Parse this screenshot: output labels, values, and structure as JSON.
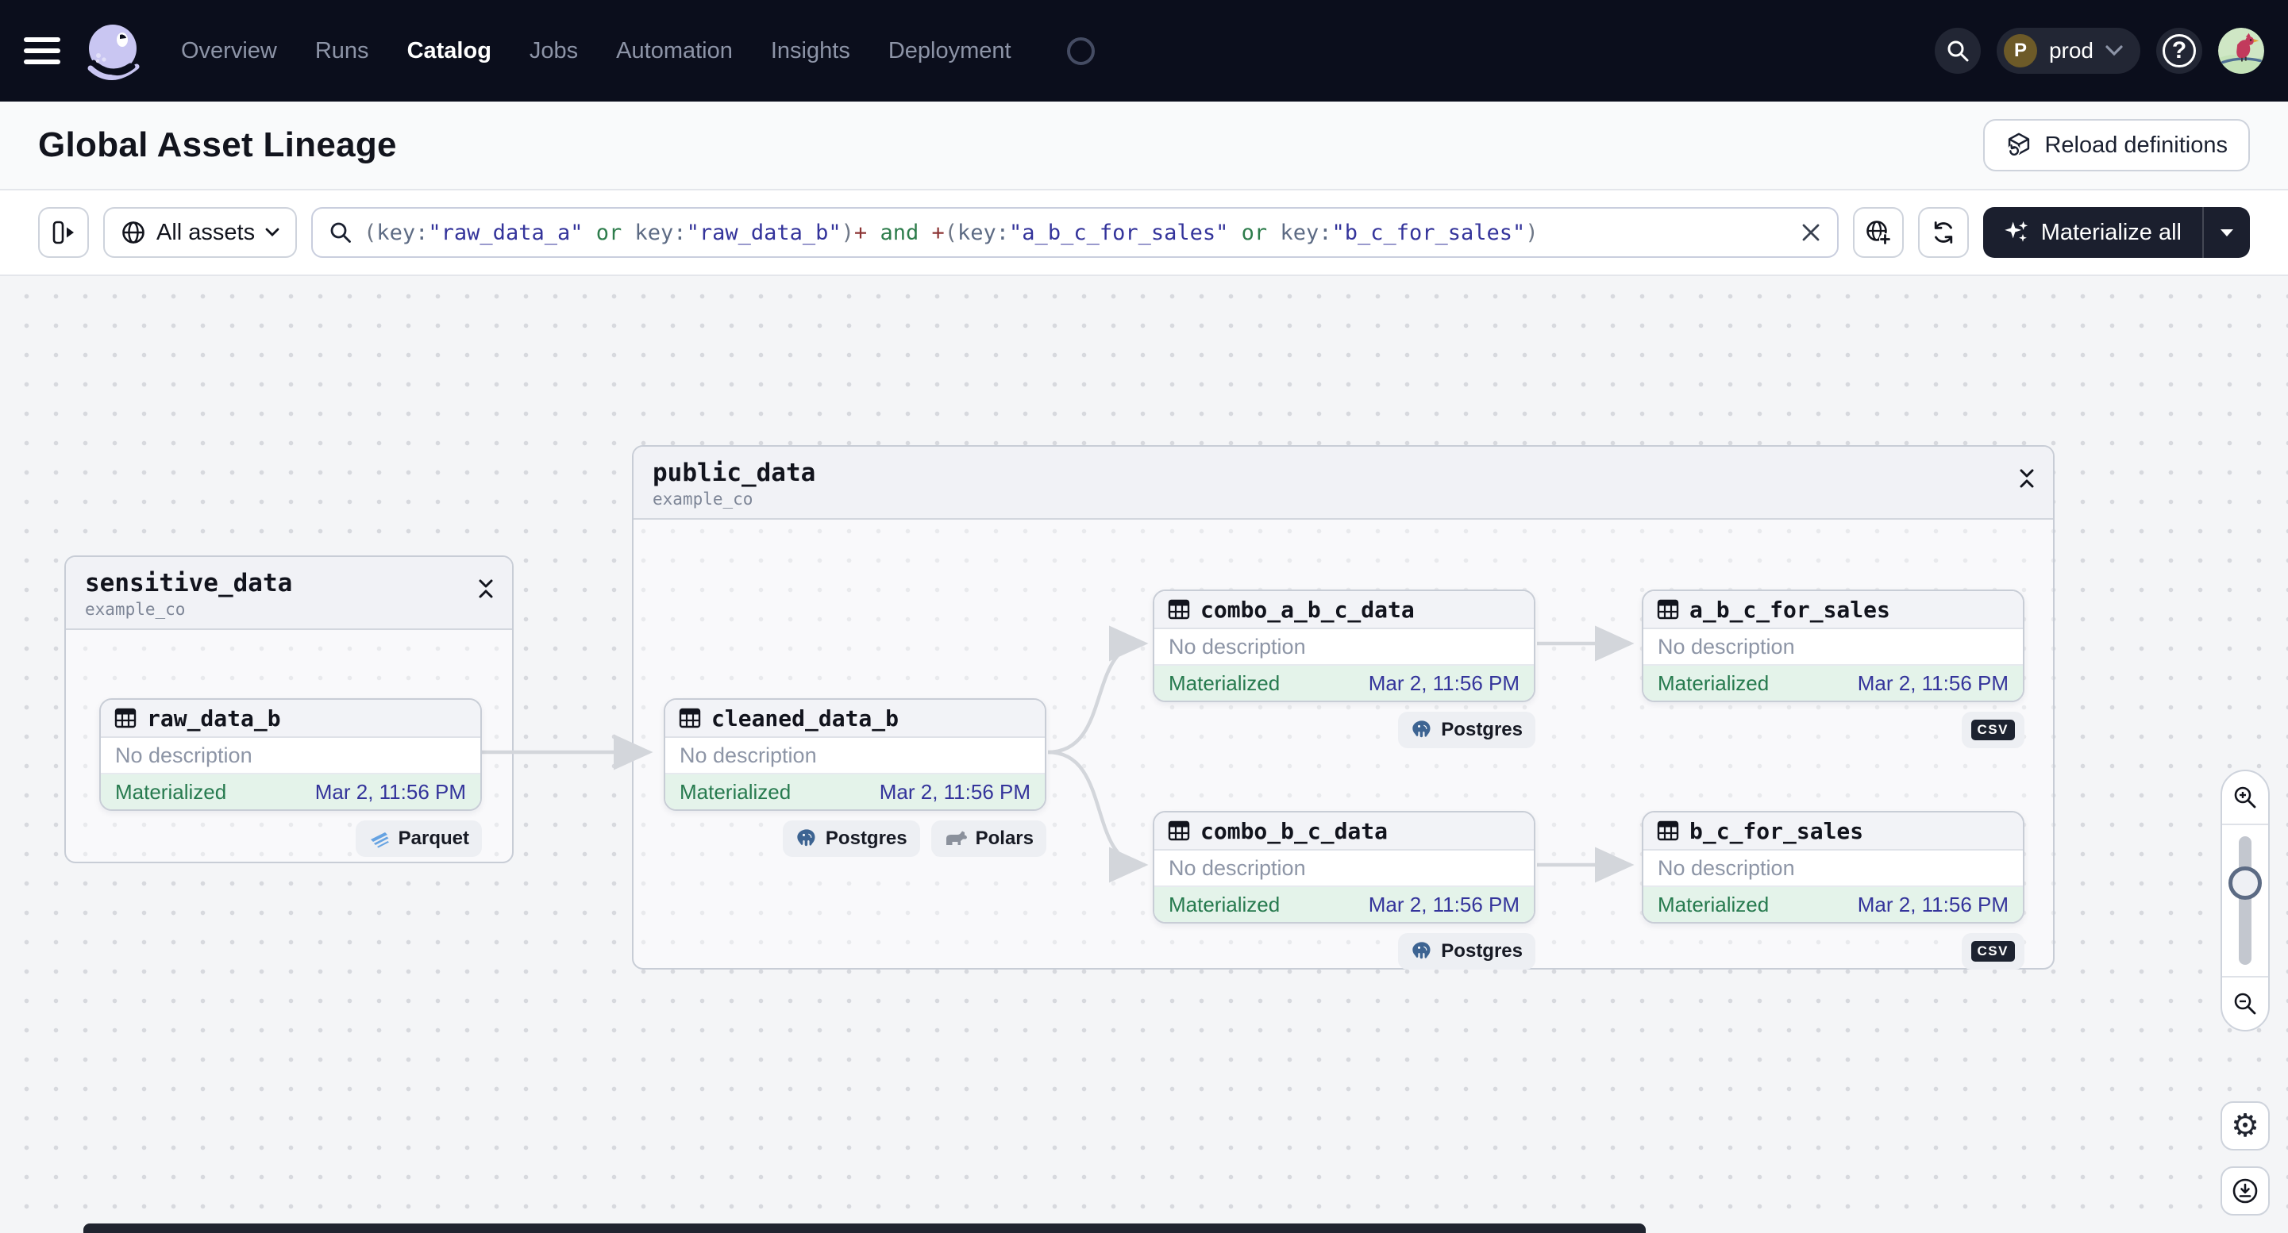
{
  "navbar": {
    "items": [
      {
        "label": "Overview",
        "active": false
      },
      {
        "label": "Runs",
        "active": false
      },
      {
        "label": "Catalog",
        "active": true
      },
      {
        "label": "Jobs",
        "active": false
      },
      {
        "label": "Automation",
        "active": false
      },
      {
        "label": "Insights",
        "active": false
      },
      {
        "label": "Deployment",
        "active": false
      }
    ],
    "environment": {
      "initial": "P",
      "name": "prod"
    }
  },
  "header": {
    "title": "Global Asset Lineage",
    "reload_button": "Reload definitions"
  },
  "filter": {
    "scope_label": "All assets",
    "materialize_label": "Materialize all",
    "query": "(key:\"raw_data_a\" or key:\"raw_data_b\")+ and +(key:\"a_b_c_for_sales\" or key:\"b_c_for_sales\")",
    "query_tokens": [
      {
        "text": "(",
        "type": "paren"
      },
      {
        "text": "key:",
        "type": "field"
      },
      {
        "text": "\"raw_data_a\"",
        "type": "str"
      },
      {
        "text": " ",
        "type": "sp"
      },
      {
        "text": "or",
        "type": "op"
      },
      {
        "text": " ",
        "type": "sp"
      },
      {
        "text": "key:",
        "type": "field"
      },
      {
        "text": "\"raw_data_b\"",
        "type": "str"
      },
      {
        "text": ")",
        "type": "paren"
      },
      {
        "text": "+",
        "type": "plus"
      },
      {
        "text": " ",
        "type": "sp"
      },
      {
        "text": "and",
        "type": "op"
      },
      {
        "text": " ",
        "type": "sp"
      },
      {
        "text": "+",
        "type": "plus"
      },
      {
        "text": "(",
        "type": "paren"
      },
      {
        "text": "key:",
        "type": "field"
      },
      {
        "text": "\"a_b_c_for_sales\"",
        "type": "str"
      },
      {
        "text": " ",
        "type": "sp"
      },
      {
        "text": "or",
        "type": "op"
      },
      {
        "text": " ",
        "type": "sp"
      },
      {
        "text": "key:",
        "type": "field"
      },
      {
        "text": "\"b_c_for_sales\"",
        "type": "str"
      },
      {
        "text": ")",
        "type": "paren"
      }
    ]
  },
  "graph": {
    "groups": [
      {
        "title": "sensitive_data",
        "subtitle": "example_co"
      },
      {
        "title": "public_data",
        "subtitle": "example_co"
      }
    ],
    "nodes": [
      {
        "name": "raw_data_b",
        "description": "No description",
        "status": "Materialized",
        "timestamp": "Mar 2, 11:56 PM",
        "tags": [
          {
            "label": "Parquet",
            "icon": "parquet-icon"
          }
        ]
      },
      {
        "name": "cleaned_data_b",
        "description": "No description",
        "status": "Materialized",
        "timestamp": "Mar 2, 11:56 PM",
        "tags": [
          {
            "label": "Postgres",
            "icon": "postgres-icon"
          },
          {
            "label": "Polars",
            "icon": "polars-icon"
          }
        ]
      },
      {
        "name": "combo_a_b_c_data",
        "description": "No description",
        "status": "Materialized",
        "timestamp": "Mar 2, 11:56 PM",
        "tags": [
          {
            "label": "Postgres",
            "icon": "postgres-icon"
          }
        ]
      },
      {
        "name": "a_b_c_for_sales",
        "description": "No description",
        "status": "Materialized",
        "timestamp": "Mar 2, 11:56 PM",
        "tags": [
          {
            "label": "csv",
            "icon": "csv-badge-icon"
          }
        ]
      },
      {
        "name": "combo_b_c_data",
        "description": "No description",
        "status": "Materialized",
        "timestamp": "Mar 2, 11:56 PM",
        "tags": [
          {
            "label": "Postgres",
            "icon": "postgres-icon"
          }
        ]
      },
      {
        "name": "b_c_for_sales",
        "description": "No description",
        "status": "Materialized",
        "timestamp": "Mar 2, 11:56 PM",
        "tags": [
          {
            "label": "csv",
            "icon": "csv-badge-icon"
          }
        ]
      }
    ]
  },
  "colors": {
    "navbar_bg": "#0b0e1c",
    "status_green": "#267a4e",
    "status_bg_green": "#e4f3ea",
    "timestamp_indigo": "#34349b",
    "edge_gray": "#d3d6db",
    "logo_lavender": "#c9c6f2"
  }
}
